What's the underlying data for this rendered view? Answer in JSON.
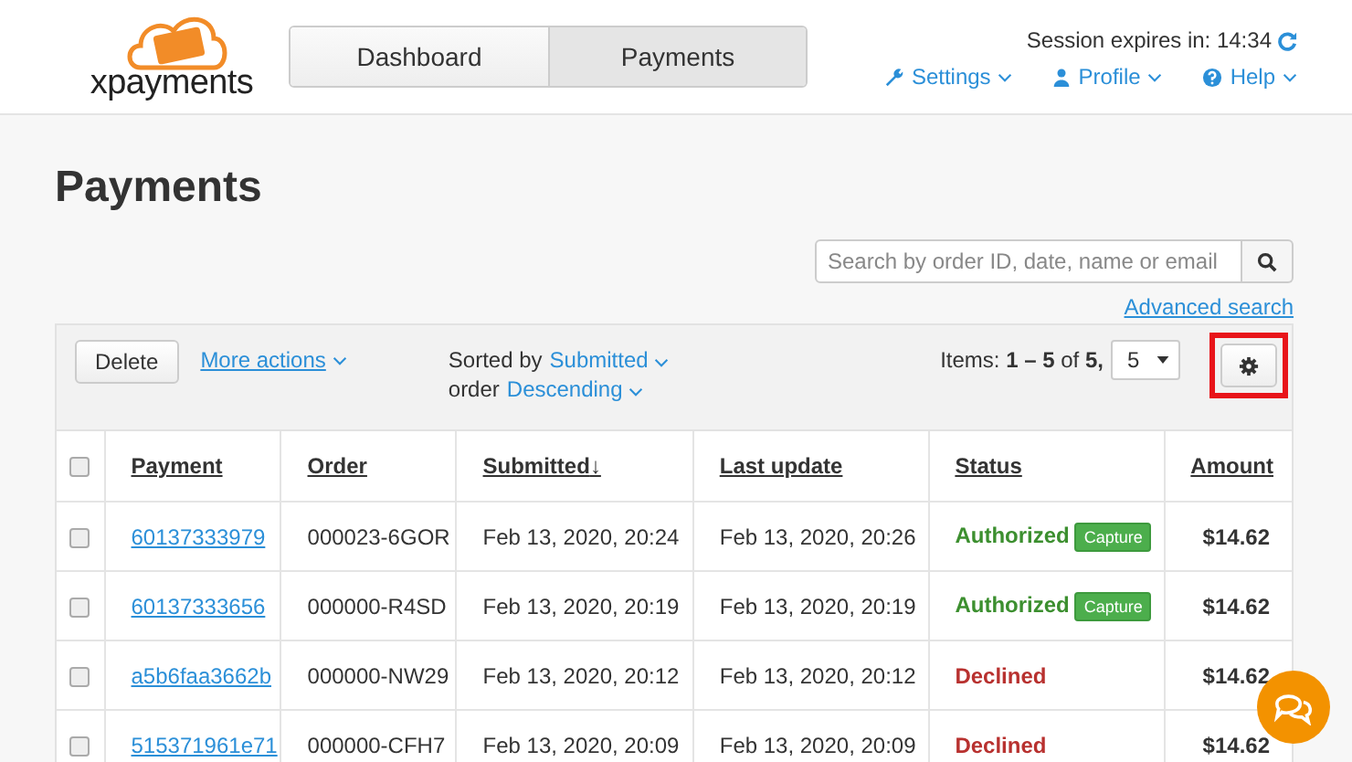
{
  "logo": {
    "text": "xpayments"
  },
  "tabs": [
    {
      "label": "Dashboard",
      "selected": false
    },
    {
      "label": "Payments",
      "selected": true
    }
  ],
  "session": {
    "label": "Session expires in: 14:34"
  },
  "nav": [
    {
      "label": "Settings"
    },
    {
      "label": "Profile"
    },
    {
      "label": "Help"
    }
  ],
  "page_title": "Payments",
  "search": {
    "placeholder": "Search by order ID, date, name or email"
  },
  "advanced_search": "Advanced search",
  "toolbar": {
    "delete": "Delete",
    "more_actions": "More actions",
    "sorted_by_label": "Sorted by",
    "sort_field": "Submitted",
    "order_label": "order",
    "order_value": "Descending",
    "items_label": "Items:",
    "items_range": "1 – 5",
    "items_of": "of",
    "items_total": "5,",
    "per_page": "5",
    "settings_highlighted": true
  },
  "table": {
    "select_all": false,
    "columns": [
      {
        "label": "Payment"
      },
      {
        "label": "Order"
      },
      {
        "label": "Submitted",
        "sort_arrow": "↓"
      },
      {
        "label": "Last update"
      },
      {
        "label": "Status"
      },
      {
        "label": "Amount"
      }
    ],
    "rows": [
      {
        "checked": false,
        "payment": "60137333979",
        "order": "000023-6GOR",
        "submitted": "Feb 13, 2020, 20:24",
        "last_update": "Feb 13, 2020, 20:26",
        "status": "Authorized",
        "color": "#3c8f2f",
        "action": "Capture",
        "amount": "$14.62"
      },
      {
        "checked": false,
        "payment": "60137333656",
        "order": "000000-R4SD",
        "submitted": "Feb 13, 2020, 20:19",
        "last_update": "Feb 13, 2020, 20:19",
        "status": "Authorized",
        "color": "#3c8f2f",
        "action": "Capture",
        "amount": "$14.62"
      },
      {
        "checked": false,
        "payment": "a5b6faa3662b",
        "order": "000000-NW29",
        "submitted": "Feb 13, 2020, 20:12",
        "last_update": "Feb 13, 2020, 20:12",
        "status": "Declined",
        "color": "#b8312f",
        "amount": "$14.62"
      },
      {
        "checked": false,
        "payment": "515371961e71",
        "order": "000000-CFH7",
        "submitted": "Feb 13, 2020, 20:09",
        "last_update": "Feb 13, 2020, 20:09",
        "status": "Declined",
        "color": "#b8312f",
        "amount": "$14.62"
      }
    ]
  }
}
